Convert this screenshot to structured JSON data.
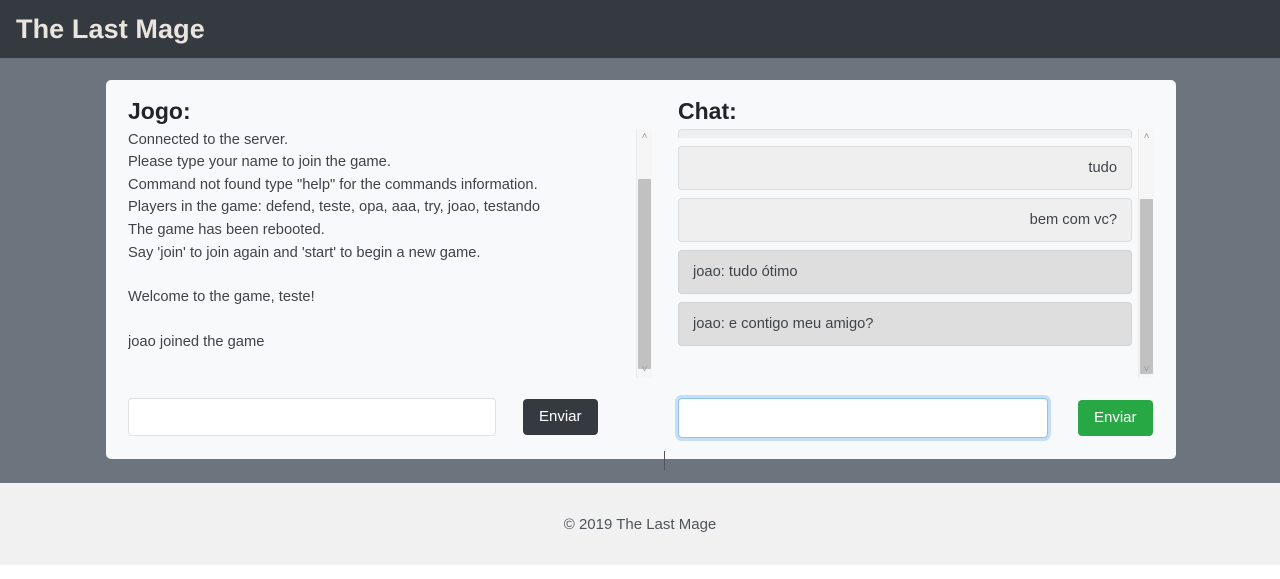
{
  "header": {
    "brand": "The Last Mage"
  },
  "colors": {
    "navbar_bg": "#343a40",
    "page_bg": "#6c757d",
    "card_bg": "#f8f9fa",
    "btn_dark": "#343a40",
    "btn_green": "#28a745",
    "focus_ring": "#8ec2f0",
    "bubble_mine": "#efefef",
    "bubble_theirs": "#dedede",
    "footer_bg": "#f1f1f1"
  },
  "game": {
    "title": "Jogo:",
    "log": [
      "Connected to the server.",
      "Please type your name to join the game.",
      "Command not found type \"help\" for the commands information.",
      "Players in the game: defend, teste, opa, aaa, try, joao, testando",
      "The game has been rebooted.",
      "Say 'join' to join again and 'start' to begin a new game.",
      "",
      "Welcome to the game, teste!",
      "",
      "joao joined the game"
    ],
    "input": {
      "value": "",
      "placeholder": ""
    },
    "send_label": "Enviar"
  },
  "chat": {
    "title": "Chat:",
    "messages": [
      {
        "text": "",
        "side": "mine",
        "clipped": true
      },
      {
        "text": "tudo",
        "side": "mine",
        "clipped": false
      },
      {
        "text": "bem com vc?",
        "side": "mine",
        "clipped": false
      },
      {
        "text": "joao: tudo ótimo",
        "side": "theirs",
        "clipped": false
      },
      {
        "text": "joao: e contigo meu amigo?",
        "side": "theirs",
        "clipped": false
      }
    ],
    "input": {
      "value": "",
      "placeholder": ""
    },
    "send_label": "Enviar",
    "focused": true
  },
  "scrollbars": {
    "game": {
      "up": "˄",
      "down": "˅",
      "thumb_top_pct": 14,
      "thumb_height_pct": 76
    },
    "chat": {
      "up": "˄",
      "down": "˅",
      "thumb_top_pct": 22,
      "thumb_height_pct": 70
    }
  },
  "footer": {
    "text": "© 2019 The Last Mage"
  }
}
